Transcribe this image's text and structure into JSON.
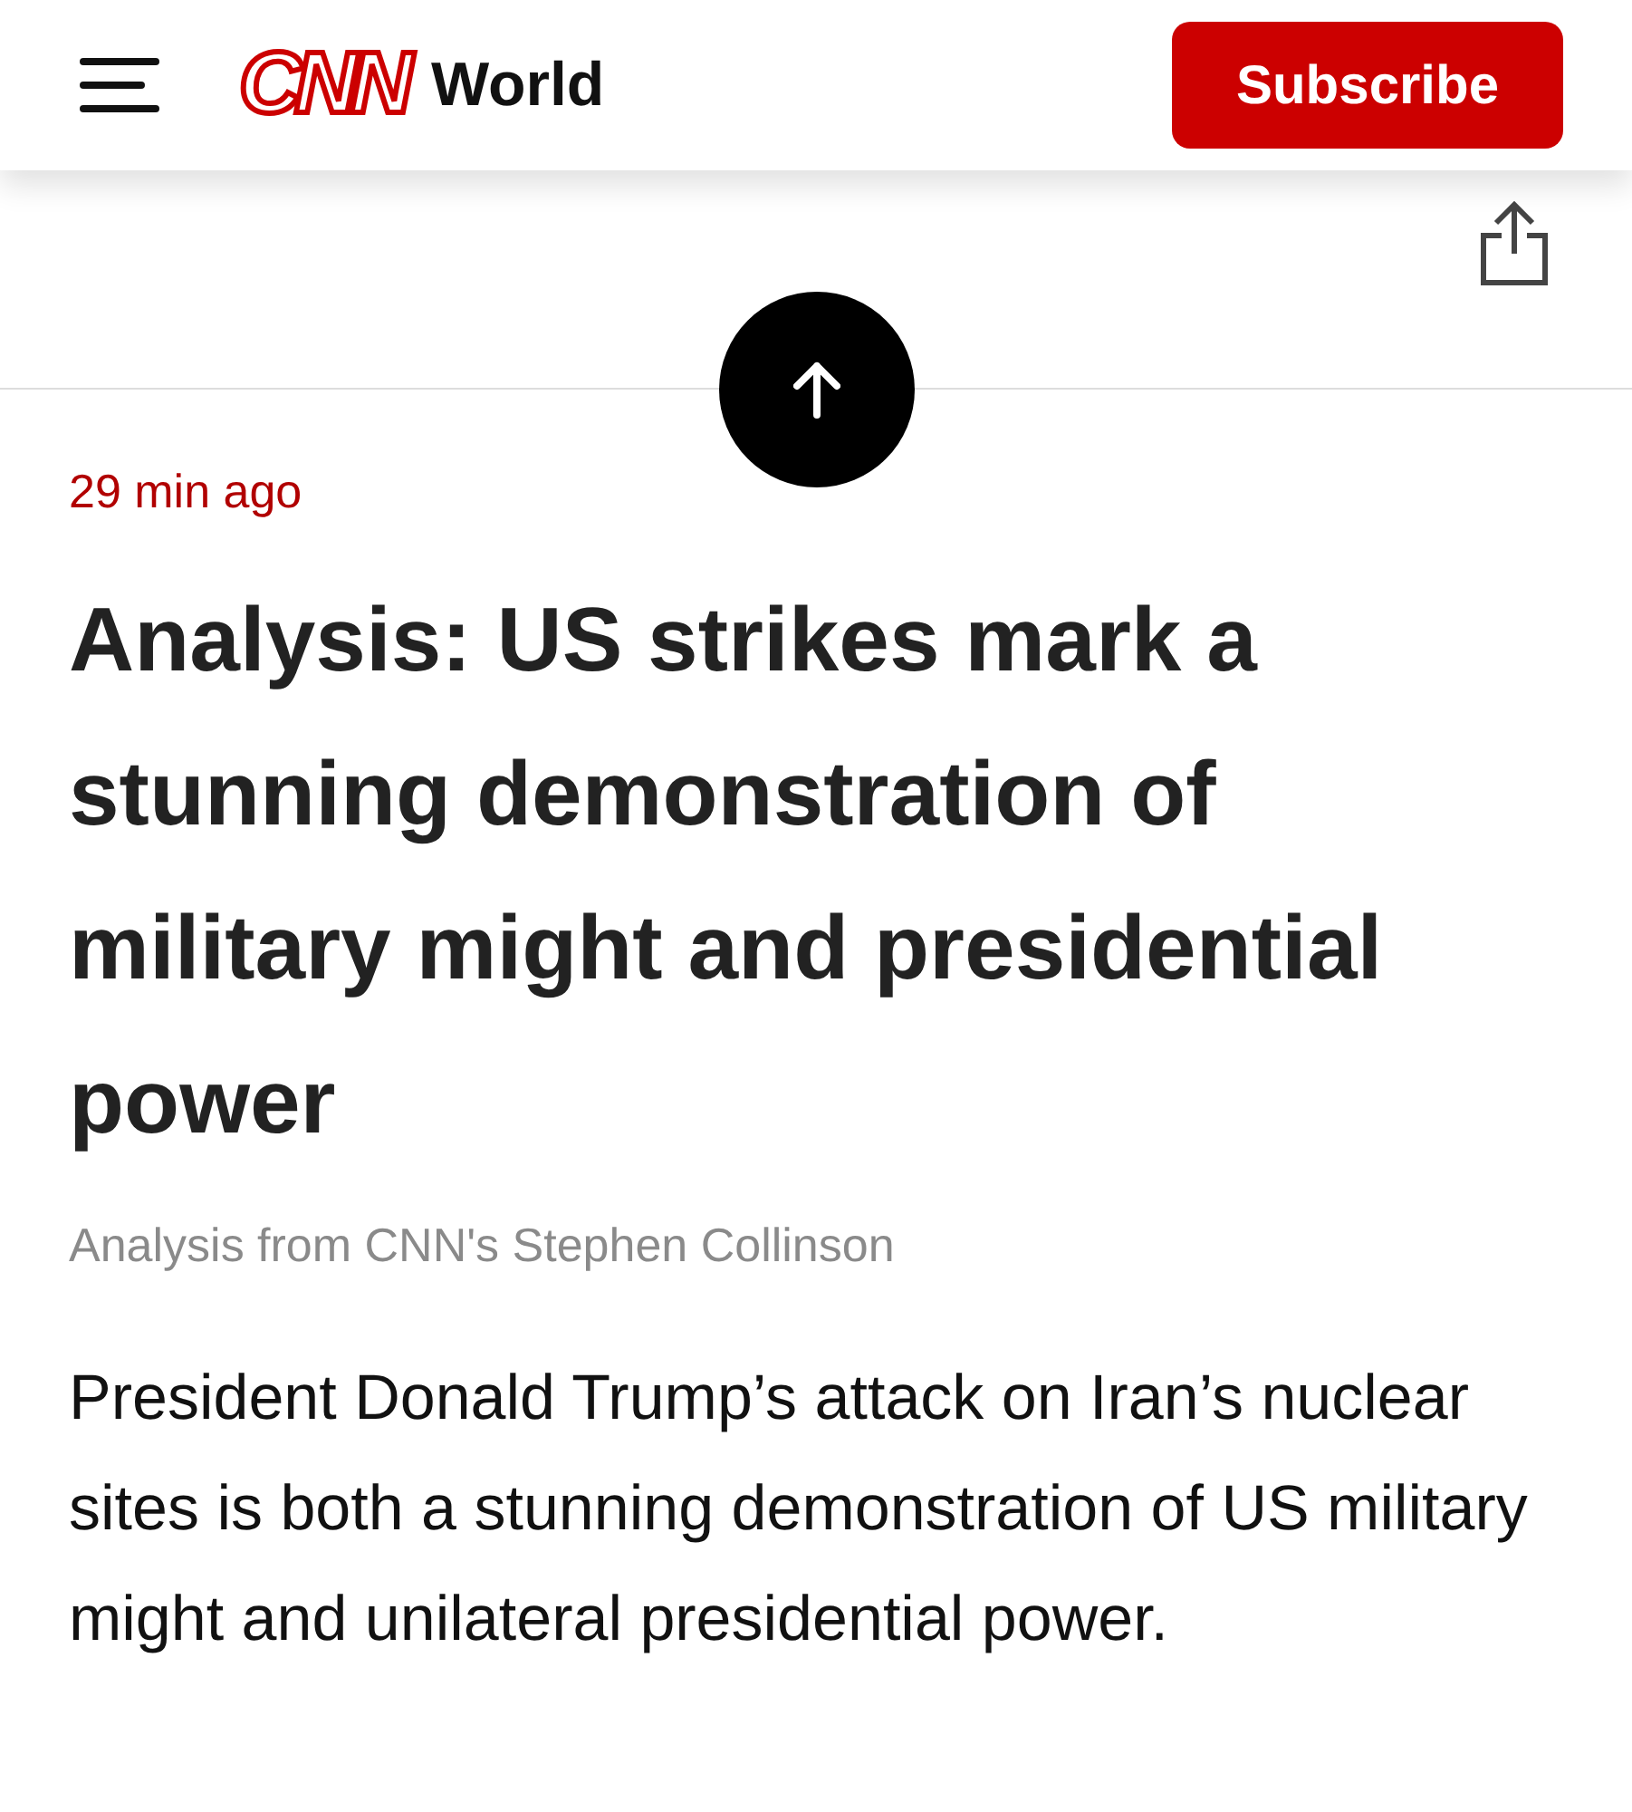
{
  "header": {
    "logo": "CNN",
    "section": "World",
    "subscribe": "Subscribe"
  },
  "article": {
    "timestamp": "29 min ago",
    "headline": "Analysis: US strikes mark a stunning demonstration of military might and presidential power",
    "byline": "Analysis from CNN's Stephen Collinson",
    "body": "President Donald Trump’s attack on Iran’s nuclear sites is both a stunning demonstration of US military might and unilateral presidential power."
  }
}
